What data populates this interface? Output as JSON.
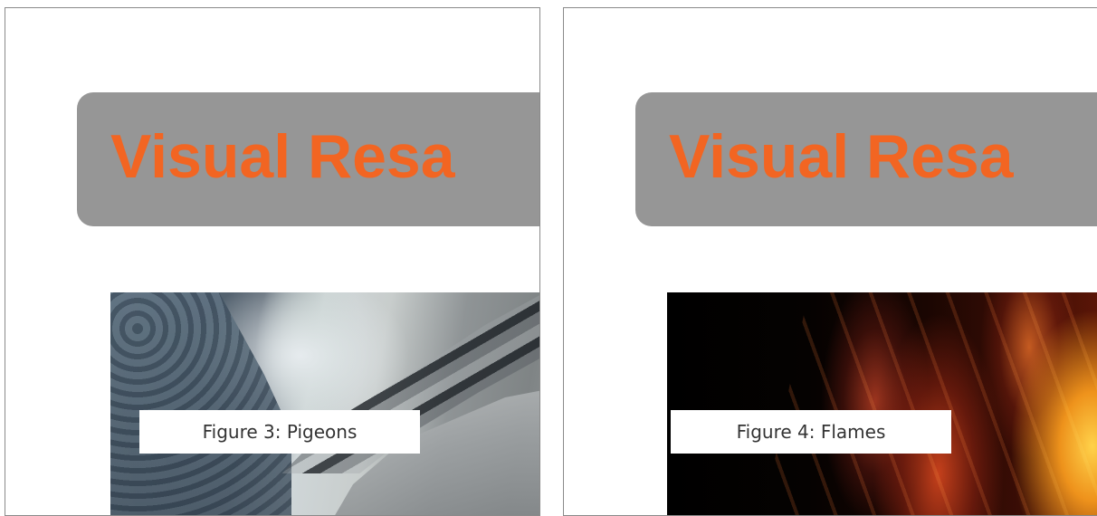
{
  "slides": [
    {
      "banner_title": "Visual Resa",
      "image": "pigeons-photo",
      "caption": "Figure 3: Pigeons"
    },
    {
      "banner_title": "Visual Resa",
      "image": "flames-photo",
      "caption": "Figure 4: Flames"
    }
  ],
  "colors": {
    "banner_background": "#969696",
    "banner_text": "#f26522",
    "panel_border": "#8a8a8a"
  }
}
